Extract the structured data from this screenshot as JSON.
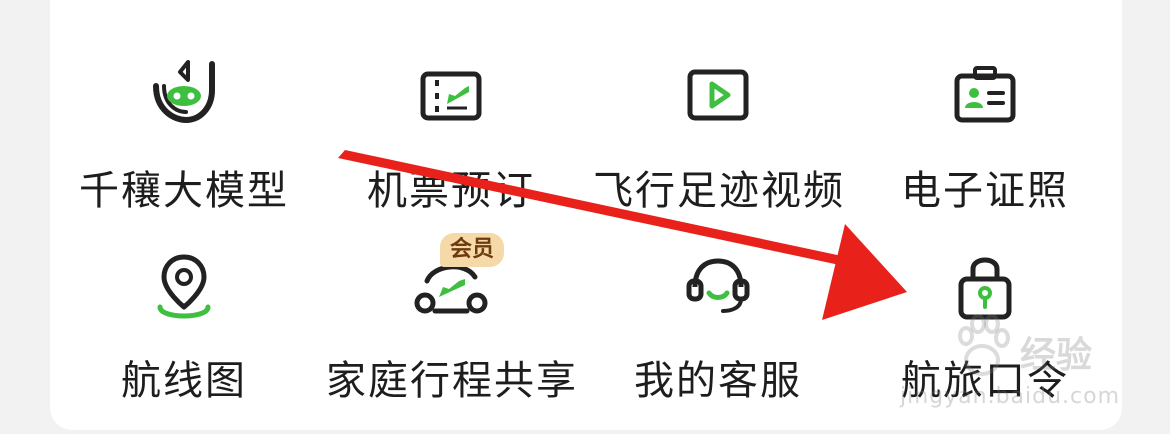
{
  "menu": {
    "items": [
      {
        "label": "千穰大模型",
        "icon": "ai-model-icon"
      },
      {
        "label": "机票预订",
        "icon": "flight-ticket-icon"
      },
      {
        "label": "飞行足迹视频",
        "icon": "video-play-icon"
      },
      {
        "label": "电子证照",
        "icon": "id-card-icon"
      },
      {
        "label": "航线图",
        "icon": "location-pin-icon"
      },
      {
        "label": "家庭行程共享",
        "icon": "family-trip-icon"
      },
      {
        "label": "我的客服",
        "icon": "headset-icon"
      },
      {
        "label": "航旅口令",
        "icon": "lock-icon"
      }
    ],
    "member_badge": "会员"
  },
  "watermark": {
    "text": "经验",
    "url": "jingyan.baidu.com"
  },
  "colors": {
    "accent_green": "#3fbf3f",
    "icon_dark": "#222222",
    "arrow_red": "#e8221b"
  }
}
